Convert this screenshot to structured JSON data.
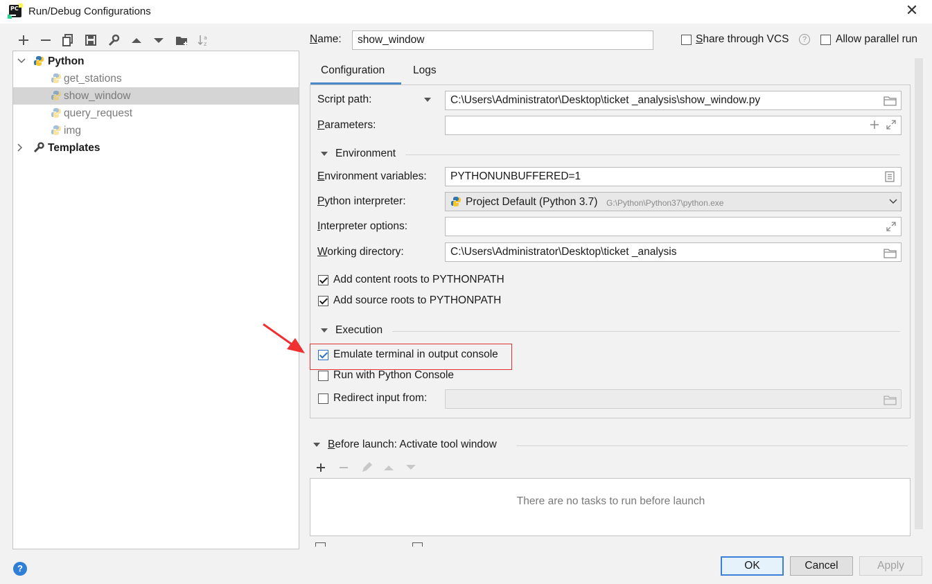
{
  "window": {
    "title": "Run/Debug Configurations",
    "close_glyph": "✕"
  },
  "toolbar": {
    "icons": [
      "add-icon",
      "remove-icon",
      "copy-icon",
      "save-icon",
      "wrench-icon",
      "move-up-icon",
      "move-down-icon",
      "folder-add-icon",
      "sort-icon"
    ]
  },
  "tree": {
    "python": {
      "label": "Python",
      "expanded": true
    },
    "items": [
      {
        "label": "get_stations",
        "selected": false
      },
      {
        "label": "show_window",
        "selected": true
      },
      {
        "label": "query_request",
        "selected": false
      },
      {
        "label": "img",
        "selected": false
      }
    ],
    "templates": {
      "label": "Templates",
      "expanded": false
    }
  },
  "header": {
    "name_label_u": "N",
    "name_label_rest": "ame:",
    "name_value": "show_window",
    "share_vcs_u": "S",
    "share_vcs_rest": "hare through VCS",
    "share_vcs_checked": false,
    "help_glyph": "?",
    "parallel_label": "Allow parallel run",
    "parallel_checked": false
  },
  "tabs": {
    "configuration": "Configuration",
    "logs": "Logs",
    "active": "Configuration"
  },
  "config": {
    "script_path_label": "Script path:",
    "script_path_value": "C:\\Users\\Administrator\\Desktop\\ticket _analysis\\show_window.py",
    "parameters_u": "P",
    "parameters_rest": "arameters:",
    "parameters_value": "",
    "environment_section": "Environment",
    "env_vars_u": "E",
    "env_vars_rest": "nvironment variables:",
    "env_vars_value": "PYTHONUNBUFFERED=1",
    "interpreter_u": "P",
    "interpreter_rest": "ython interpreter:",
    "interpreter_value": "Project Default (Python 3.7)",
    "interpreter_path": "G:\\Python\\Python37\\python.exe",
    "interp_options_u": "I",
    "interp_options_rest": "nterpreter options:",
    "interp_options_value": "",
    "working_dir_u": "W",
    "working_dir_rest": "orking directory:",
    "working_dir_value": "C:\\Users\\Administrator\\Desktop\\ticket _analysis",
    "content_roots_label": "Add content roots to PYTHONPATH",
    "content_roots_checked": true,
    "source_roots_label": "Add source roots to PYTHONPATH",
    "source_roots_checked": true,
    "execution_section": "Execution",
    "emulate_terminal_label": "Emulate terminal in output console",
    "emulate_terminal_checked": true,
    "python_console_label": "Run with Python Console",
    "python_console_checked": false,
    "redirect_label": "Redirect input from:",
    "redirect_checked": false,
    "redirect_value": ""
  },
  "before_launch": {
    "title_u": "B",
    "title_rest": "efore launch: Activate tool window",
    "empty_text": "There are no tasks to run before launch"
  },
  "buttons": {
    "ok": "OK",
    "cancel": "Cancel",
    "apply": "Apply",
    "help": "?"
  },
  "colors": {
    "accent": "#4a88c7",
    "highlight_box": "#e03131",
    "selection": "#d5d5d5"
  }
}
